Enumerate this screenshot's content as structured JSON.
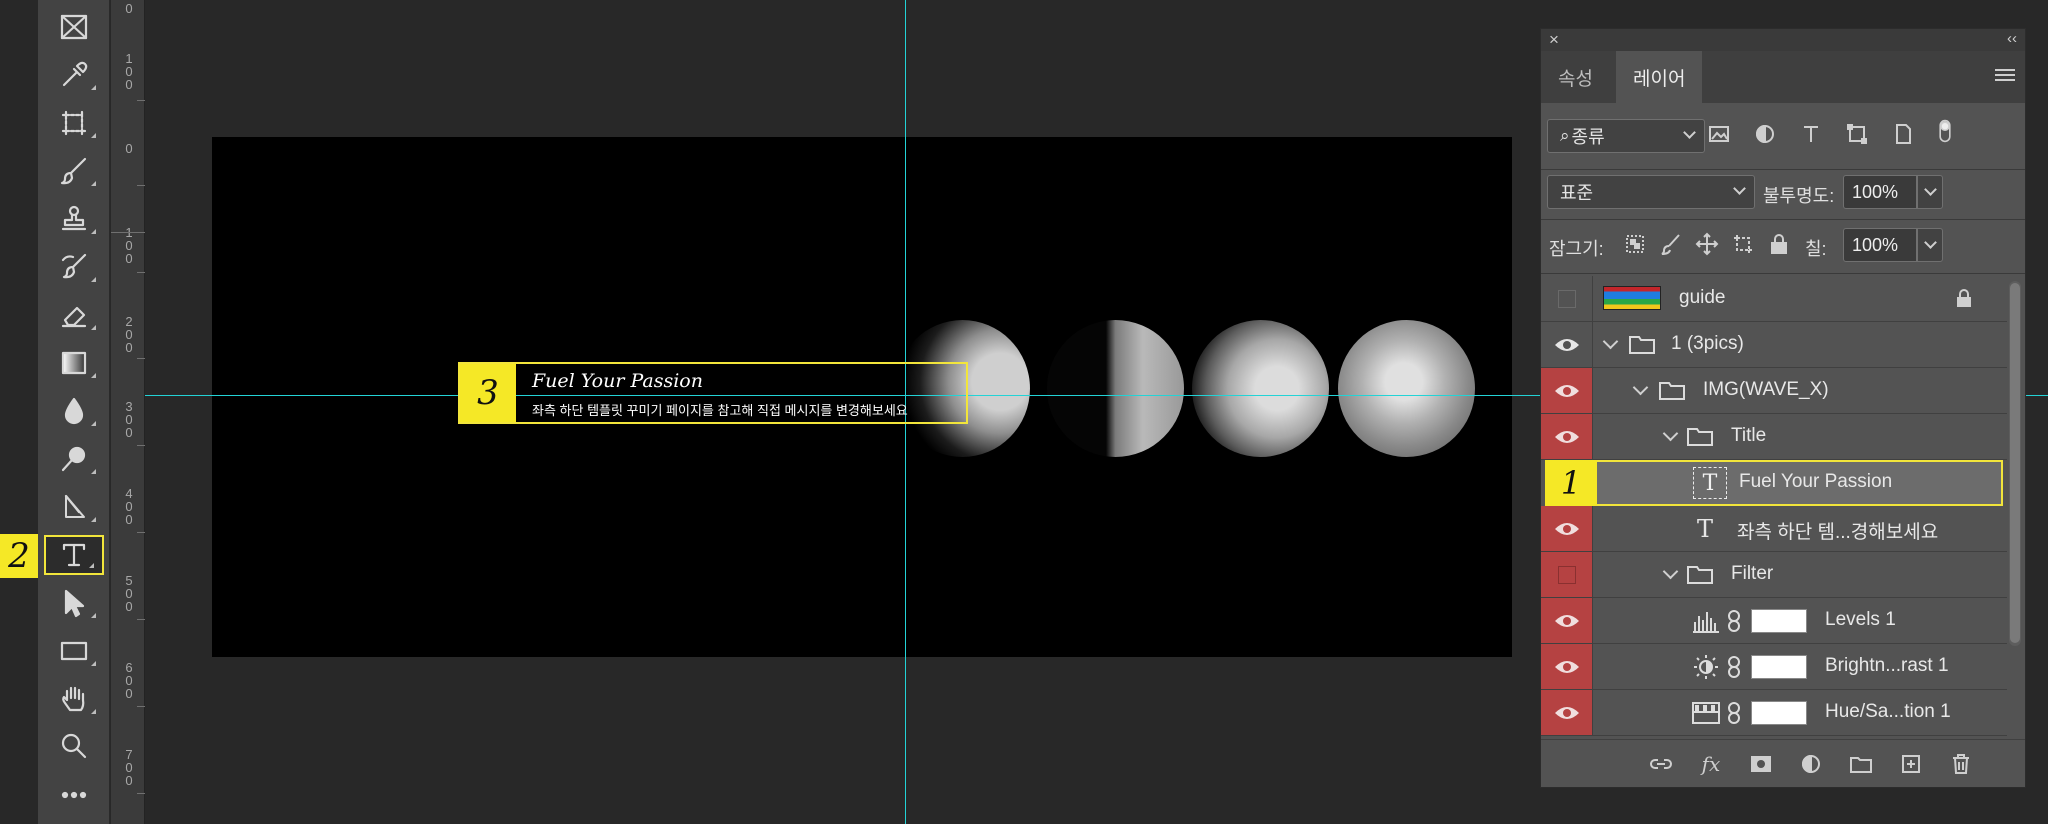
{
  "toolbar": {
    "tools": [
      {
        "id": "frame",
        "icon": "frame-tool-icon"
      },
      {
        "id": "eyedropper",
        "icon": "eyedropper-tool-icon"
      },
      {
        "id": "crop",
        "icon": "crop-tool-icon"
      },
      {
        "id": "brush",
        "icon": "brush-tool-icon"
      },
      {
        "id": "stamp",
        "icon": "clone-stamp-tool-icon"
      },
      {
        "id": "history-brush",
        "icon": "history-brush-tool-icon"
      },
      {
        "id": "eraser",
        "icon": "eraser-tool-icon"
      },
      {
        "id": "gradient",
        "icon": "gradient-tool-icon"
      },
      {
        "id": "blur",
        "icon": "blur-tool-icon"
      },
      {
        "id": "dodge",
        "icon": "dodge-tool-icon"
      },
      {
        "id": "pen",
        "icon": "pen-tool-icon"
      },
      {
        "id": "type",
        "icon": "type-tool-icon",
        "active": true
      },
      {
        "id": "path-select",
        "icon": "path-selection-tool-icon"
      },
      {
        "id": "rectangle",
        "icon": "rectangle-tool-icon"
      },
      {
        "id": "hand",
        "icon": "hand-tool-icon"
      },
      {
        "id": "zoom",
        "icon": "zoom-tool-icon"
      },
      {
        "id": "more",
        "icon": "more-tools-icon"
      }
    ],
    "badge_number": "2"
  },
  "ruler": {
    "labels": [
      "0",
      "1\n0\n0",
      "0",
      "1\n0\n0",
      "2\n0\n0",
      "3\n0\n0",
      "4\n0\n0",
      "5\n0\n0",
      "6\n0\n0",
      "7\n0\n0"
    ]
  },
  "canvas": {
    "title_badge": "3",
    "title_text": "Fuel Your Passion",
    "subtitle_text": "좌측 하단 템플릿 꾸미기 페이지를 참고해 직접 메시지를 변경해보세요"
  },
  "layers_panel": {
    "tabs": [
      {
        "label": "속성",
        "active": false
      },
      {
        "label": "레이어",
        "active": true
      }
    ],
    "filter_kind": "종류",
    "blend_mode": "표준",
    "opacity_label": "불투명도:",
    "opacity_value": "100%",
    "lock_label": "잠그기:",
    "fill_label": "칠:",
    "fill_value": "100%",
    "selected_badge": "1",
    "layers": [
      {
        "name": "guide",
        "type": "image",
        "visible": false,
        "locked": true
      },
      {
        "name": "1 (3pics)",
        "type": "group",
        "visible": true
      },
      {
        "name": "IMG(WAVE_X)",
        "type": "group",
        "visible": true
      },
      {
        "name": "Title",
        "type": "group",
        "visible": true
      },
      {
        "name": "Fuel Your Passion",
        "type": "text",
        "visible": true,
        "selected": true
      },
      {
        "name": "좌측 하단 템...경해보세요",
        "type": "text",
        "visible": true
      },
      {
        "name": "Filter",
        "type": "group",
        "visible": false
      },
      {
        "name": "Levels 1",
        "type": "adjustment",
        "visible": true
      },
      {
        "name": "Brightn...rast 1",
        "type": "adjustment",
        "visible": true
      },
      {
        "name": "Hue/Sa...tion 1",
        "type": "adjustment",
        "visible": true
      }
    ]
  },
  "colors": {
    "highlight": "#f5e826",
    "guide": "#23d3d6",
    "visibility_on": "#b54242"
  }
}
